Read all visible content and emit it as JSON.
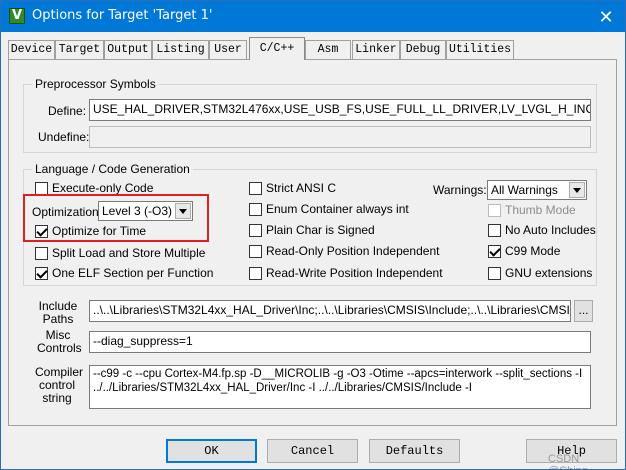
{
  "window": {
    "title": "Options for Target 'Target 1'",
    "close_glyph": "✕"
  },
  "tabs": [
    {
      "label": "Device"
    },
    {
      "label": "Target"
    },
    {
      "label": "Output"
    },
    {
      "label": "Listing"
    },
    {
      "label": "User"
    },
    {
      "label": "C/C++"
    },
    {
      "label": "Asm"
    },
    {
      "label": "Linker"
    },
    {
      "label": "Debug"
    },
    {
      "label": "Utilities"
    }
  ],
  "active_tab": "C/C++",
  "preprocessor": {
    "group_label": "Preprocessor Symbols",
    "define_label": "Define:",
    "define_value": "USE_HAL_DRIVER,STM32L476xx,USE_USB_FS,USE_FULL_LL_DRIVER,LV_LVGL_H_INCLUDE_SIMPLE",
    "undefine_label": "Undefine:",
    "undefine_value": ""
  },
  "language": {
    "group_label": "Language / Code Generation",
    "execute_only": {
      "label": "Execute-only Code",
      "checked": false
    },
    "optimization_label": "Optimization:",
    "optimization_value": "Level 3 (-O3)",
    "optimize_time": {
      "label": "Optimize for Time",
      "checked": true
    },
    "split_load": {
      "label": "Split Load and Store Multiple",
      "checked": false
    },
    "one_elf": {
      "label": "One ELF Section per Function",
      "checked": true
    },
    "strict_ansi": {
      "label": "Strict ANSI C",
      "checked": false
    },
    "enum_container": {
      "label": "Enum Container always int",
      "checked": false
    },
    "plain_char": {
      "label": "Plain Char is Signed",
      "checked": false
    },
    "ro_pi": {
      "label": "Read-Only Position Independent",
      "checked": false
    },
    "rw_pi": {
      "label": "Read-Write Position Independent",
      "checked": false
    },
    "warnings_label": "Warnings:",
    "warnings_value": "All Warnings",
    "thumb_mode": {
      "label": "Thumb Mode",
      "checked": false,
      "disabled": true
    },
    "no_auto_includes": {
      "label": "No Auto Includes",
      "checked": false
    },
    "c99_mode": {
      "label": "C99 Mode",
      "checked": true
    },
    "gnu_ext": {
      "label": "GNU extensions",
      "checked": false
    }
  },
  "include": {
    "label": "Include\nPaths",
    "value": "..\\..\\Libraries\\STM32L4xx_HAL_Driver\\Inc;..\\..\\Libraries\\CMSIS\\Include;..\\..\\Libraries\\CMSIS\\Device",
    "browse_label": "..."
  },
  "misc": {
    "label": "Misc\nControls",
    "value": "--diag_suppress=1"
  },
  "compiler": {
    "label": "Compiler\ncontrol\nstring",
    "value": "--c99 -c --cpu Cortex-M4.fp.sp -D__MICROLIB -g -O3 -Otime --apcs=interwork --split_sections -I ../../Libraries/STM32L4xx_HAL_Driver/Inc -I ../../Libraries/CMSIS/Include -I"
  },
  "buttons": {
    "ok": "OK",
    "cancel": "Cancel",
    "defaults": "Defaults",
    "help": "Help"
  },
  "watermark": "CSDN @Ching-"
}
